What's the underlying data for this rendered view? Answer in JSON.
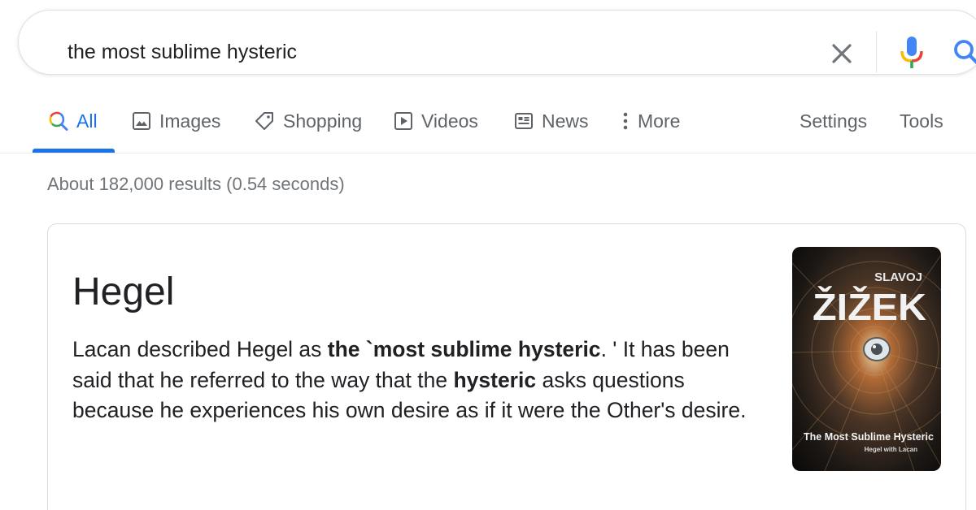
{
  "search": {
    "query": "the most sublime hysteric",
    "icons": {
      "clear": "close-icon",
      "voice": "microphone-icon",
      "search": "search-icon"
    },
    "colors": {
      "blue": "#4285f4",
      "red": "#ea4335",
      "yellow": "#fbbc05",
      "green": "#34a853"
    }
  },
  "tabs": [
    {
      "label": "All",
      "icon": "search-icon",
      "active": true
    },
    {
      "label": "Images",
      "icon": "image-icon"
    },
    {
      "label": "Shopping",
      "icon": "tag-icon"
    },
    {
      "label": "Videos",
      "icon": "play-icon"
    },
    {
      "label": "News",
      "icon": "newspaper-icon"
    },
    {
      "label": "More",
      "icon": "vertical-dots-icon"
    }
  ],
  "tools": {
    "settings": "Settings",
    "tools": "Tools"
  },
  "result_stats": "About 182,000 results (0.54 seconds)",
  "card": {
    "title": "Hegel",
    "description": {
      "p1": "Lacan described Hegel as ",
      "b1": "the `most sublime hysteric",
      "p2": ". ' It has been said that he referred to the way that the ",
      "b2": "hysteric",
      "p3": " asks questions because he experiences his own desire as if it were the Other's desire."
    },
    "book": {
      "author_first": "SLAVOJ",
      "author_last": "ŽIŽEK",
      "title": "The Most Sublime Hysteric",
      "subtitle": "Hegel with Lacan"
    }
  },
  "accent": "#1a73e8"
}
